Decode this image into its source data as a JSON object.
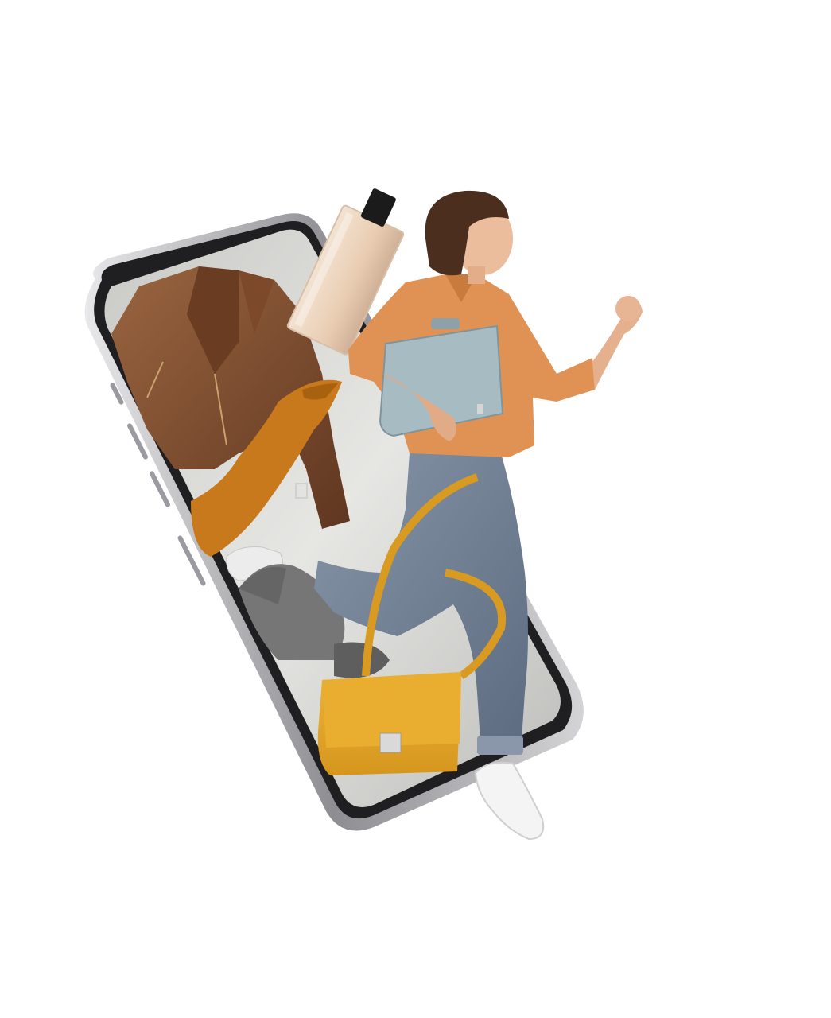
{
  "scene": {
    "subject": "woman-running-out-of-smartphone",
    "items": [
      "leather-jacket",
      "perfume-bottle",
      "orange-scarf",
      "sneaker",
      "cap",
      "yellow-handbag",
      "record-player-case"
    ]
  },
  "colors": {
    "background": "#ffffff",
    "phone_frame": "#2b2b2d",
    "phone_edge": "#c9c9cc",
    "screen": "#d8d8d6",
    "jacket_leather": "#7a4a2a",
    "scarf": "#c8791a",
    "handbag": "#e0a62a",
    "shirt": "#e0945a",
    "jeans": "#6f7f95",
    "case": "#a9bcc4",
    "hair": "#4a2e1e",
    "skin": "#e8b596",
    "cap": "#6f6f6f",
    "sneaker": "#f2f2f2"
  }
}
